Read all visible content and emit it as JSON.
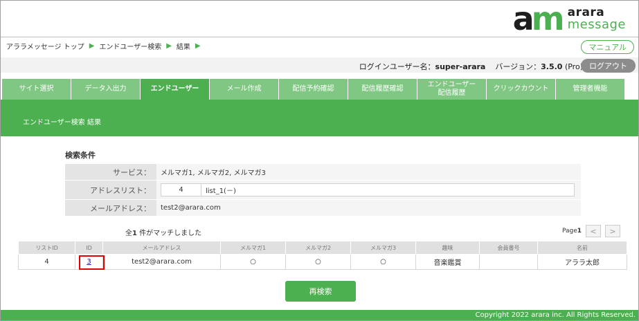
{
  "logo": {
    "mark_a": "a",
    "mark_m": "m",
    "line1": "arara",
    "line2": "message"
  },
  "breadcrumb": [
    {
      "label": "アララメッセージ トップ"
    },
    {
      "label": "エンドユーザー検索"
    },
    {
      "label": "結果"
    }
  ],
  "breadcrumb_sep": "▶",
  "header": {
    "manual_label": "マニュアル",
    "user_label": "ログインユーザー名：",
    "user_name": "super-arara",
    "version_label": "バージョン：",
    "version": "3.5.0",
    "edition": "(Pro)",
    "logout_label": "ログアウト"
  },
  "tabs": [
    {
      "label": "サイト選択"
    },
    {
      "label": "データ入出力"
    },
    {
      "label": "エンドユーザー"
    },
    {
      "label": "メール作成"
    },
    {
      "label": "配信予約確認"
    },
    {
      "label": "配信履歴確認"
    },
    {
      "label": "エンドユーザー\n配信履歴"
    },
    {
      "label": "クリックカウント"
    },
    {
      "label": "管理者機能"
    }
  ],
  "active_tab": "エンドユーザー",
  "page_title": "エンドユーザー検索 結果",
  "conditions": {
    "title": "検索条件",
    "service_label": "サービス：",
    "service_value": "メルマガ1, メルマガ2, メルマガ3",
    "address_list_label": "アドレスリスト：",
    "address_list_num": "4",
    "address_list_name": "list_1(－)",
    "email_label": "メールアドレス：",
    "email_value": "test2@arara.com"
  },
  "match": {
    "prefix": "全",
    "count": "1",
    "suffix": " 件がマッチしました"
  },
  "pager": {
    "label": "Page",
    "page": "1",
    "prev": "<",
    "next": ">"
  },
  "table": {
    "headers": [
      "リストID",
      "ID",
      "メールアドレス",
      "メルマガ1",
      "メルマガ2",
      "メルマガ3",
      "趣味",
      "会員番号",
      "名前"
    ],
    "rows": [
      {
        "list_id": "4",
        "id": "3",
        "email": "test2@arara.com",
        "m1": "○",
        "m2": "○",
        "m3": "○",
        "hobby": "音楽鑑賞",
        "member_no": "",
        "name": "アララ太郎"
      }
    ]
  },
  "research_label": "再検索",
  "footer": "Copyright 2022 arara inc. All Rights Reserved.",
  "colors": {
    "brand_green": "#4caf50",
    "tab_green": "#81c784",
    "highlight_red": "#e00000"
  }
}
